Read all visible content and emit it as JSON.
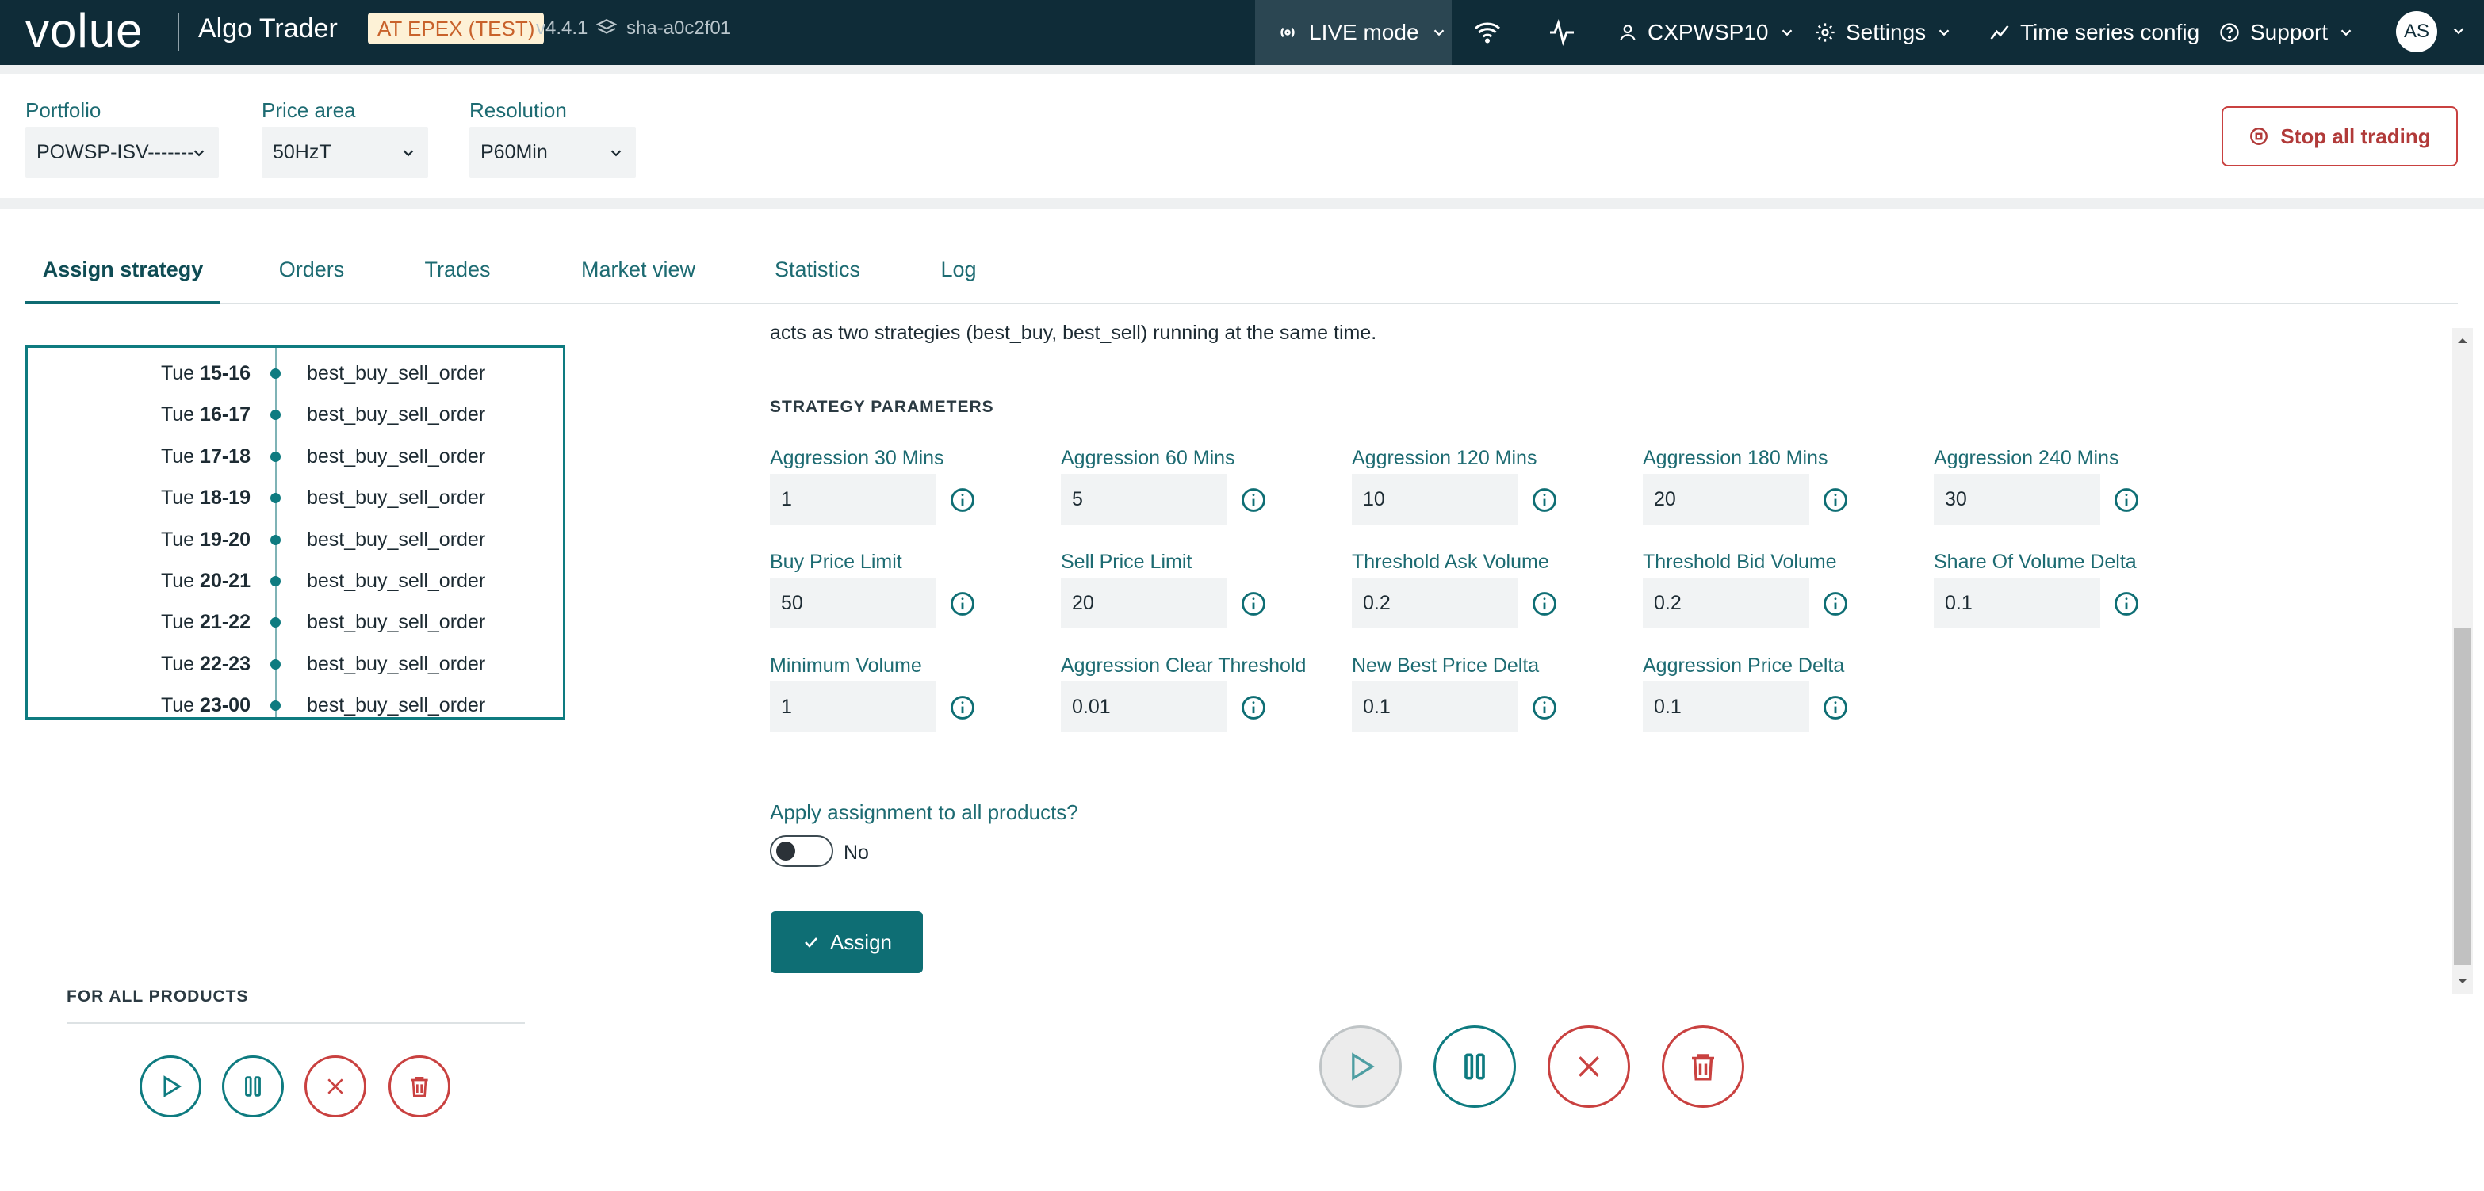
{
  "header": {
    "logo": "volue",
    "app_name": "Algo Trader",
    "env_badge": "AT EPEX (TEST)",
    "version": "v4.4.1",
    "sha": "sha-a0c2f01",
    "live_mode": "LIVE mode",
    "user": "CXPWSP10",
    "settings": "Settings",
    "time_series_config": "Time series config",
    "support": "Support",
    "avatar_initials": "AS"
  },
  "selectors": {
    "portfolio": {
      "label": "Portfolio",
      "value": "POWSP-ISV-------"
    },
    "price_area": {
      "label": "Price area",
      "value": "50HzT"
    },
    "resolution": {
      "label": "Resolution",
      "value": "P60Min"
    },
    "stop_all_trading": "Stop all trading"
  },
  "tabs": [
    "Assign strategy",
    "Orders",
    "Trades",
    "Market view",
    "Statistics",
    "Log"
  ],
  "products": [
    {
      "day": "Tue ",
      "hours": "15-16",
      "strategy": "best_buy_sell_order"
    },
    {
      "day": "Tue ",
      "hours": "16-17",
      "strategy": "best_buy_sell_order"
    },
    {
      "day": "Tue ",
      "hours": "17-18",
      "strategy": "best_buy_sell_order"
    },
    {
      "day": "Tue ",
      "hours": "18-19",
      "strategy": "best_buy_sell_order"
    },
    {
      "day": "Tue ",
      "hours": "19-20",
      "strategy": "best_buy_sell_order"
    },
    {
      "day": "Tue ",
      "hours": "20-21",
      "strategy": "best_buy_sell_order"
    },
    {
      "day": "Tue ",
      "hours": "21-22",
      "strategy": "best_buy_sell_order"
    },
    {
      "day": "Tue ",
      "hours": "22-23",
      "strategy": "best_buy_sell_order"
    },
    {
      "day": "Tue ",
      "hours": "23-00",
      "strategy": "best_buy_sell_order"
    }
  ],
  "strategy": {
    "description": "acts as two strategies (best_buy, best_sell) running at the same time.",
    "params_title": "STRATEGY PARAMETERS",
    "params": [
      {
        "label": "Aggression 30 Mins",
        "value": "1"
      },
      {
        "label": "Aggression 60 Mins",
        "value": "5"
      },
      {
        "label": "Aggression 120 Mins",
        "value": "10"
      },
      {
        "label": "Aggression 180 Mins",
        "value": "20"
      },
      {
        "label": "Aggression 240 Mins",
        "value": "30"
      },
      {
        "label": "Buy Price Limit",
        "value": "50"
      },
      {
        "label": "Sell Price Limit",
        "value": "20"
      },
      {
        "label": "Threshold Ask Volume",
        "value": "0.2"
      },
      {
        "label": "Threshold Bid Volume",
        "value": "0.2"
      },
      {
        "label": "Share Of Volume Delta",
        "value": "0.1"
      },
      {
        "label": "Minimum Volume",
        "value": "1"
      },
      {
        "label": "Aggression Clear Threshold",
        "value": "0.01"
      },
      {
        "label": "New Best Price Delta",
        "value": "0.1"
      },
      {
        "label": "Aggression Price Delta",
        "value": "0.1"
      }
    ],
    "apply_all_label": "Apply assignment to all products?",
    "apply_all_value": "No",
    "assign_button": "Assign"
  },
  "for_all_products": {
    "title": "FOR ALL PRODUCTS"
  },
  "colors": {
    "teal": "#0e7b80",
    "red": "#c94140",
    "header_bg": "#0f2c38"
  }
}
